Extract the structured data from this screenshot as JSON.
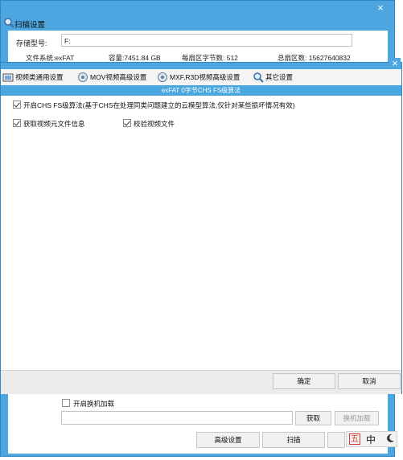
{
  "back_window": {
    "title": "扫描设置",
    "close_glyph": "×",
    "storage_label": "存储型号:",
    "storage_value": "F:",
    "fs_text": "文件系统:exFAT",
    "capacity_text": "容量:7451.84 GB",
    "sector_bytes_text": "每扇区字节数: 512",
    "total_sectors_text": "总扇区数: 15627640832",
    "hot_load_label": "开启换机加载",
    "fetch_button": "获取",
    "hot_load_button": "换机加载",
    "advanced_button": "高级设置",
    "scan_button": "扫描"
  },
  "front_dialog": {
    "close_glyph": "×",
    "tabs": [
      {
        "label": "视频类通用设置",
        "icon": "video-icon"
      },
      {
        "label": "MOV视频高级设置",
        "icon": "mov-icon"
      },
      {
        "label": "MXF,R3D视频高级设置",
        "icon": "mxf-icon"
      },
      {
        "label": "其它设置",
        "icon": "magnifier-icon"
      }
    ],
    "subtitle": "exFAT 0字节CHS FS级算法",
    "options": {
      "chs_label": "开启CHS FS级算法(基于CHS在处理同类问题建立的云模型算法,仅针对某些损坏情况有效)",
      "chs_checked": true,
      "meta_label": "获取视频元文件信息",
      "meta_checked": true,
      "verify_label": "校验视频文件",
      "verify_checked": true
    },
    "ok_button": "确定",
    "cancel_button": "取消"
  },
  "ime": {
    "wubi": "五",
    "zhong": "中"
  },
  "colors": {
    "title_blue": "#4da6df",
    "subbar_blue": "#4aa6de",
    "ime_red": "#d23b30"
  }
}
